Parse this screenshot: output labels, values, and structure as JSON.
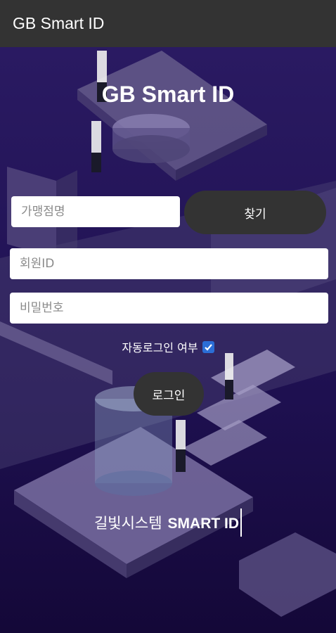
{
  "appbar": {
    "title": "GB Smart ID"
  },
  "hero": {
    "title": "GB Smart ID"
  },
  "form": {
    "store_placeholder": "가맹점명",
    "find_label": "찾기",
    "member_id_placeholder": "회원ID",
    "password_placeholder": "비밀번호",
    "auto_login_label": "자동로그인 여부",
    "auto_login_checked": true,
    "login_label": "로그인"
  },
  "footer": {
    "text_kr": "길빛시스템",
    "brand": "SMART ID"
  },
  "colors": {
    "background": "#1b0e4a",
    "appbar": "#333333",
    "button": "#333333",
    "checkbox": "#2b6ed6"
  }
}
